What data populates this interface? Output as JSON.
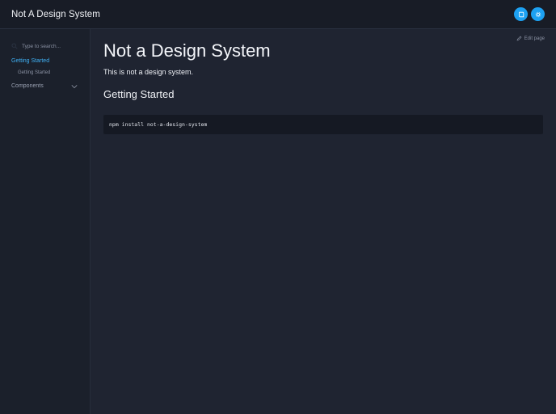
{
  "header": {
    "brand": "Not A Design System",
    "buttons": [
      {
        "icon": "book-icon"
      },
      {
        "icon": "settings-icon"
      }
    ]
  },
  "sidebar": {
    "search": {
      "placeholder": "Type to search..."
    },
    "sections": [
      {
        "label": "Getting Started",
        "active": true,
        "items": [
          {
            "label": "Getting Started"
          }
        ]
      },
      {
        "label": "Components",
        "collapsed": true
      }
    ]
  },
  "main": {
    "edit_label": "Edit page",
    "title": "Not a Design System",
    "intro": "This is not a design system.",
    "section_title": "Getting Started",
    "code": "npm install not-a-design-system"
  },
  "colors": {
    "accent": "#1da1f2",
    "link_active": "#3fb1f5",
    "background": "#1f2431",
    "header": "#181c26",
    "sidebar": "#1b202b",
    "code_bg": "#151923"
  }
}
